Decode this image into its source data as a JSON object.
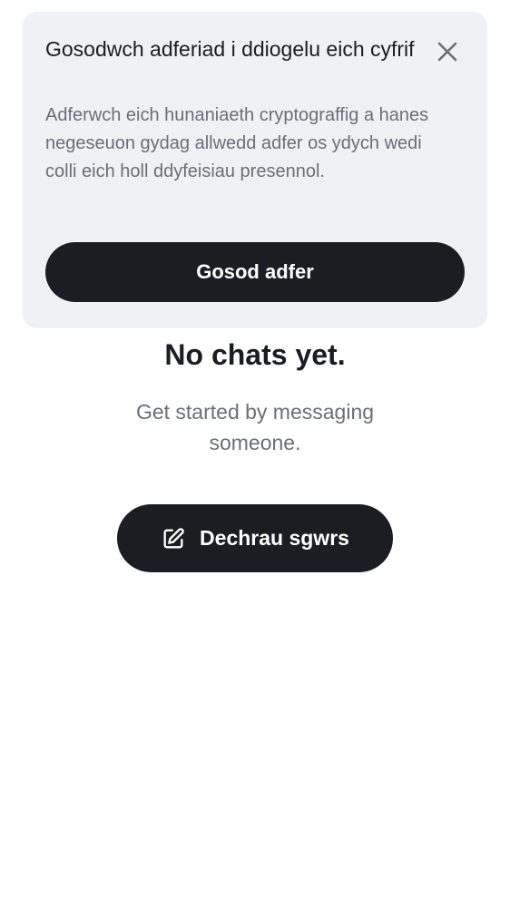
{
  "banner": {
    "title": "Gosodwch adferiad i ddiogelu eich cyfrif",
    "body": "Adferwch eich hunaniaeth cryptograffig a hanes negeseuon gydag allwedd adfer os ydych wedi colli eich holl ddyfeisiau presennol.",
    "primary_button": "Gosod adfer",
    "close_icon": "close-icon"
  },
  "empty_state": {
    "title": "No chats yet.",
    "subtitle": "Get started by messaging someone.",
    "start_button": "Dechrau sgwrs",
    "start_icon": "compose-icon"
  },
  "colors": {
    "banner_background": "#eff1f4",
    "button_background": "#1b1d22",
    "button_text": "#ffffff",
    "text_primary": "#1b1d22",
    "text_secondary": "#6a6f78"
  }
}
